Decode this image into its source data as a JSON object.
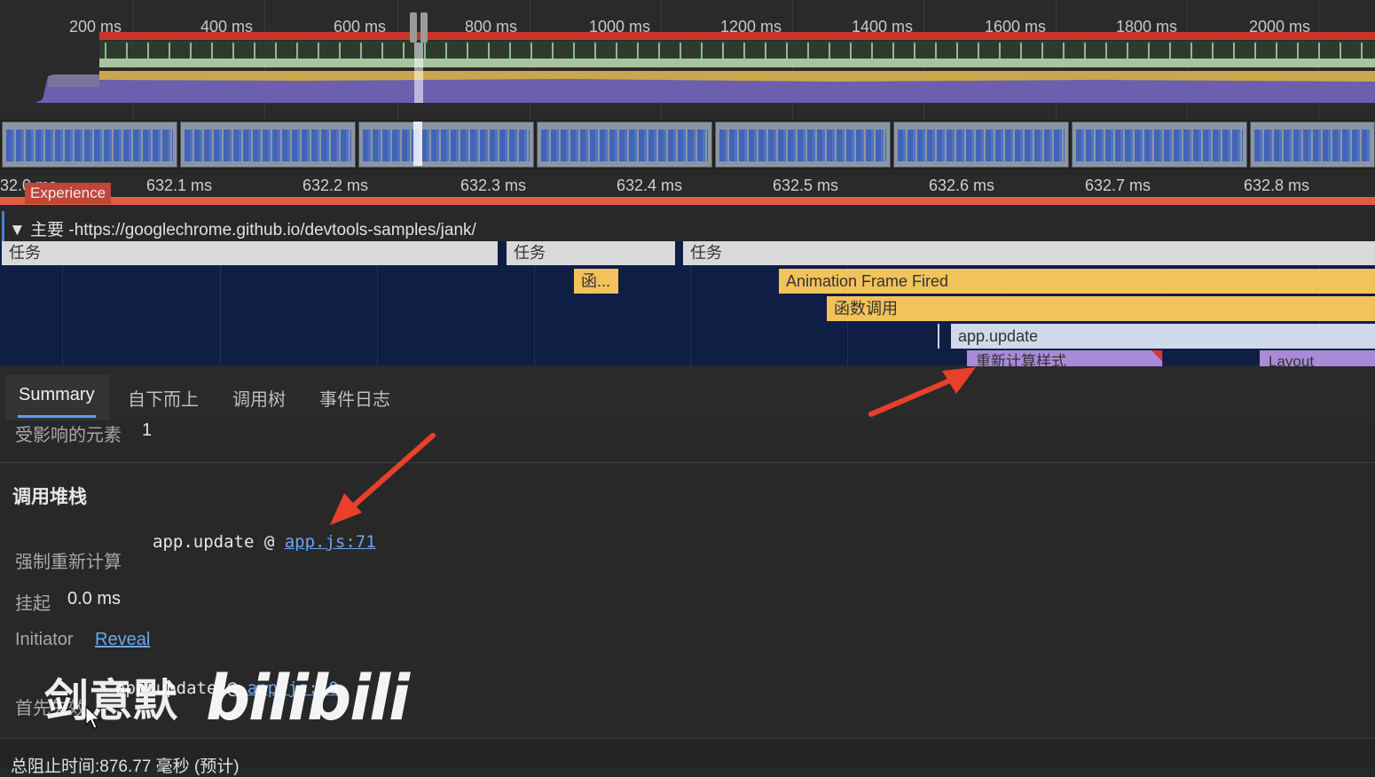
{
  "overview": {
    "ticks": [
      "200 ms",
      "400 ms",
      "600 ms",
      "800 ms",
      "1000 ms",
      "1200 ms",
      "1400 ms",
      "1600 ms",
      "1800 ms",
      "2000 ms"
    ]
  },
  "ruler": {
    "start_label": "32.0 ms",
    "experience_label": "Experience",
    "ticks": [
      "632.1 ms",
      "632.2 ms",
      "632.3 ms",
      "632.4 ms",
      "632.5 ms",
      "632.6 ms",
      "632.7 ms",
      "632.8 ms"
    ]
  },
  "main": {
    "toggle": "▼",
    "title": "主要 -https://googlechrome.github.io/devtools-samples/jank/",
    "tasks": [
      "任务",
      "任务",
      "任务"
    ],
    "func_short": "函...",
    "animation_frame": "Animation Frame Fired",
    "function_call": "函数调用",
    "app_update": "app.update",
    "recalc_style": "重新计算样式",
    "layout": "Layout"
  },
  "tabs": [
    "Summary",
    "自下而上",
    "调用树",
    "事件日志"
  ],
  "summary": {
    "affected_label": "受影响的元素",
    "affected_value": "1",
    "call_stack_heading": "调用堆栈",
    "forced_recalc_label": "强制重新计算",
    "forced_fn": "app.update @ ",
    "forced_link": "app.js:71",
    "pending_label": "挂起",
    "pending_value": "0.0 ms",
    "initiator_label": "Initiator",
    "initiator_link": "Reveal",
    "first_label": "首先失效",
    "first_fn": "app.update @ ",
    "first_link": "app.js:70",
    "footer_text": "总阻止时间:876.77 毫秒 (预计)"
  },
  "watermark": {
    "author": "剑意默",
    "brand": "bilibili"
  },
  "colors": {
    "accent_blue": "#5aa0f2",
    "annotation_arrow": "#e8402a",
    "animation_frame": "#f2c25b",
    "recalc_style": "#a98ad6"
  }
}
